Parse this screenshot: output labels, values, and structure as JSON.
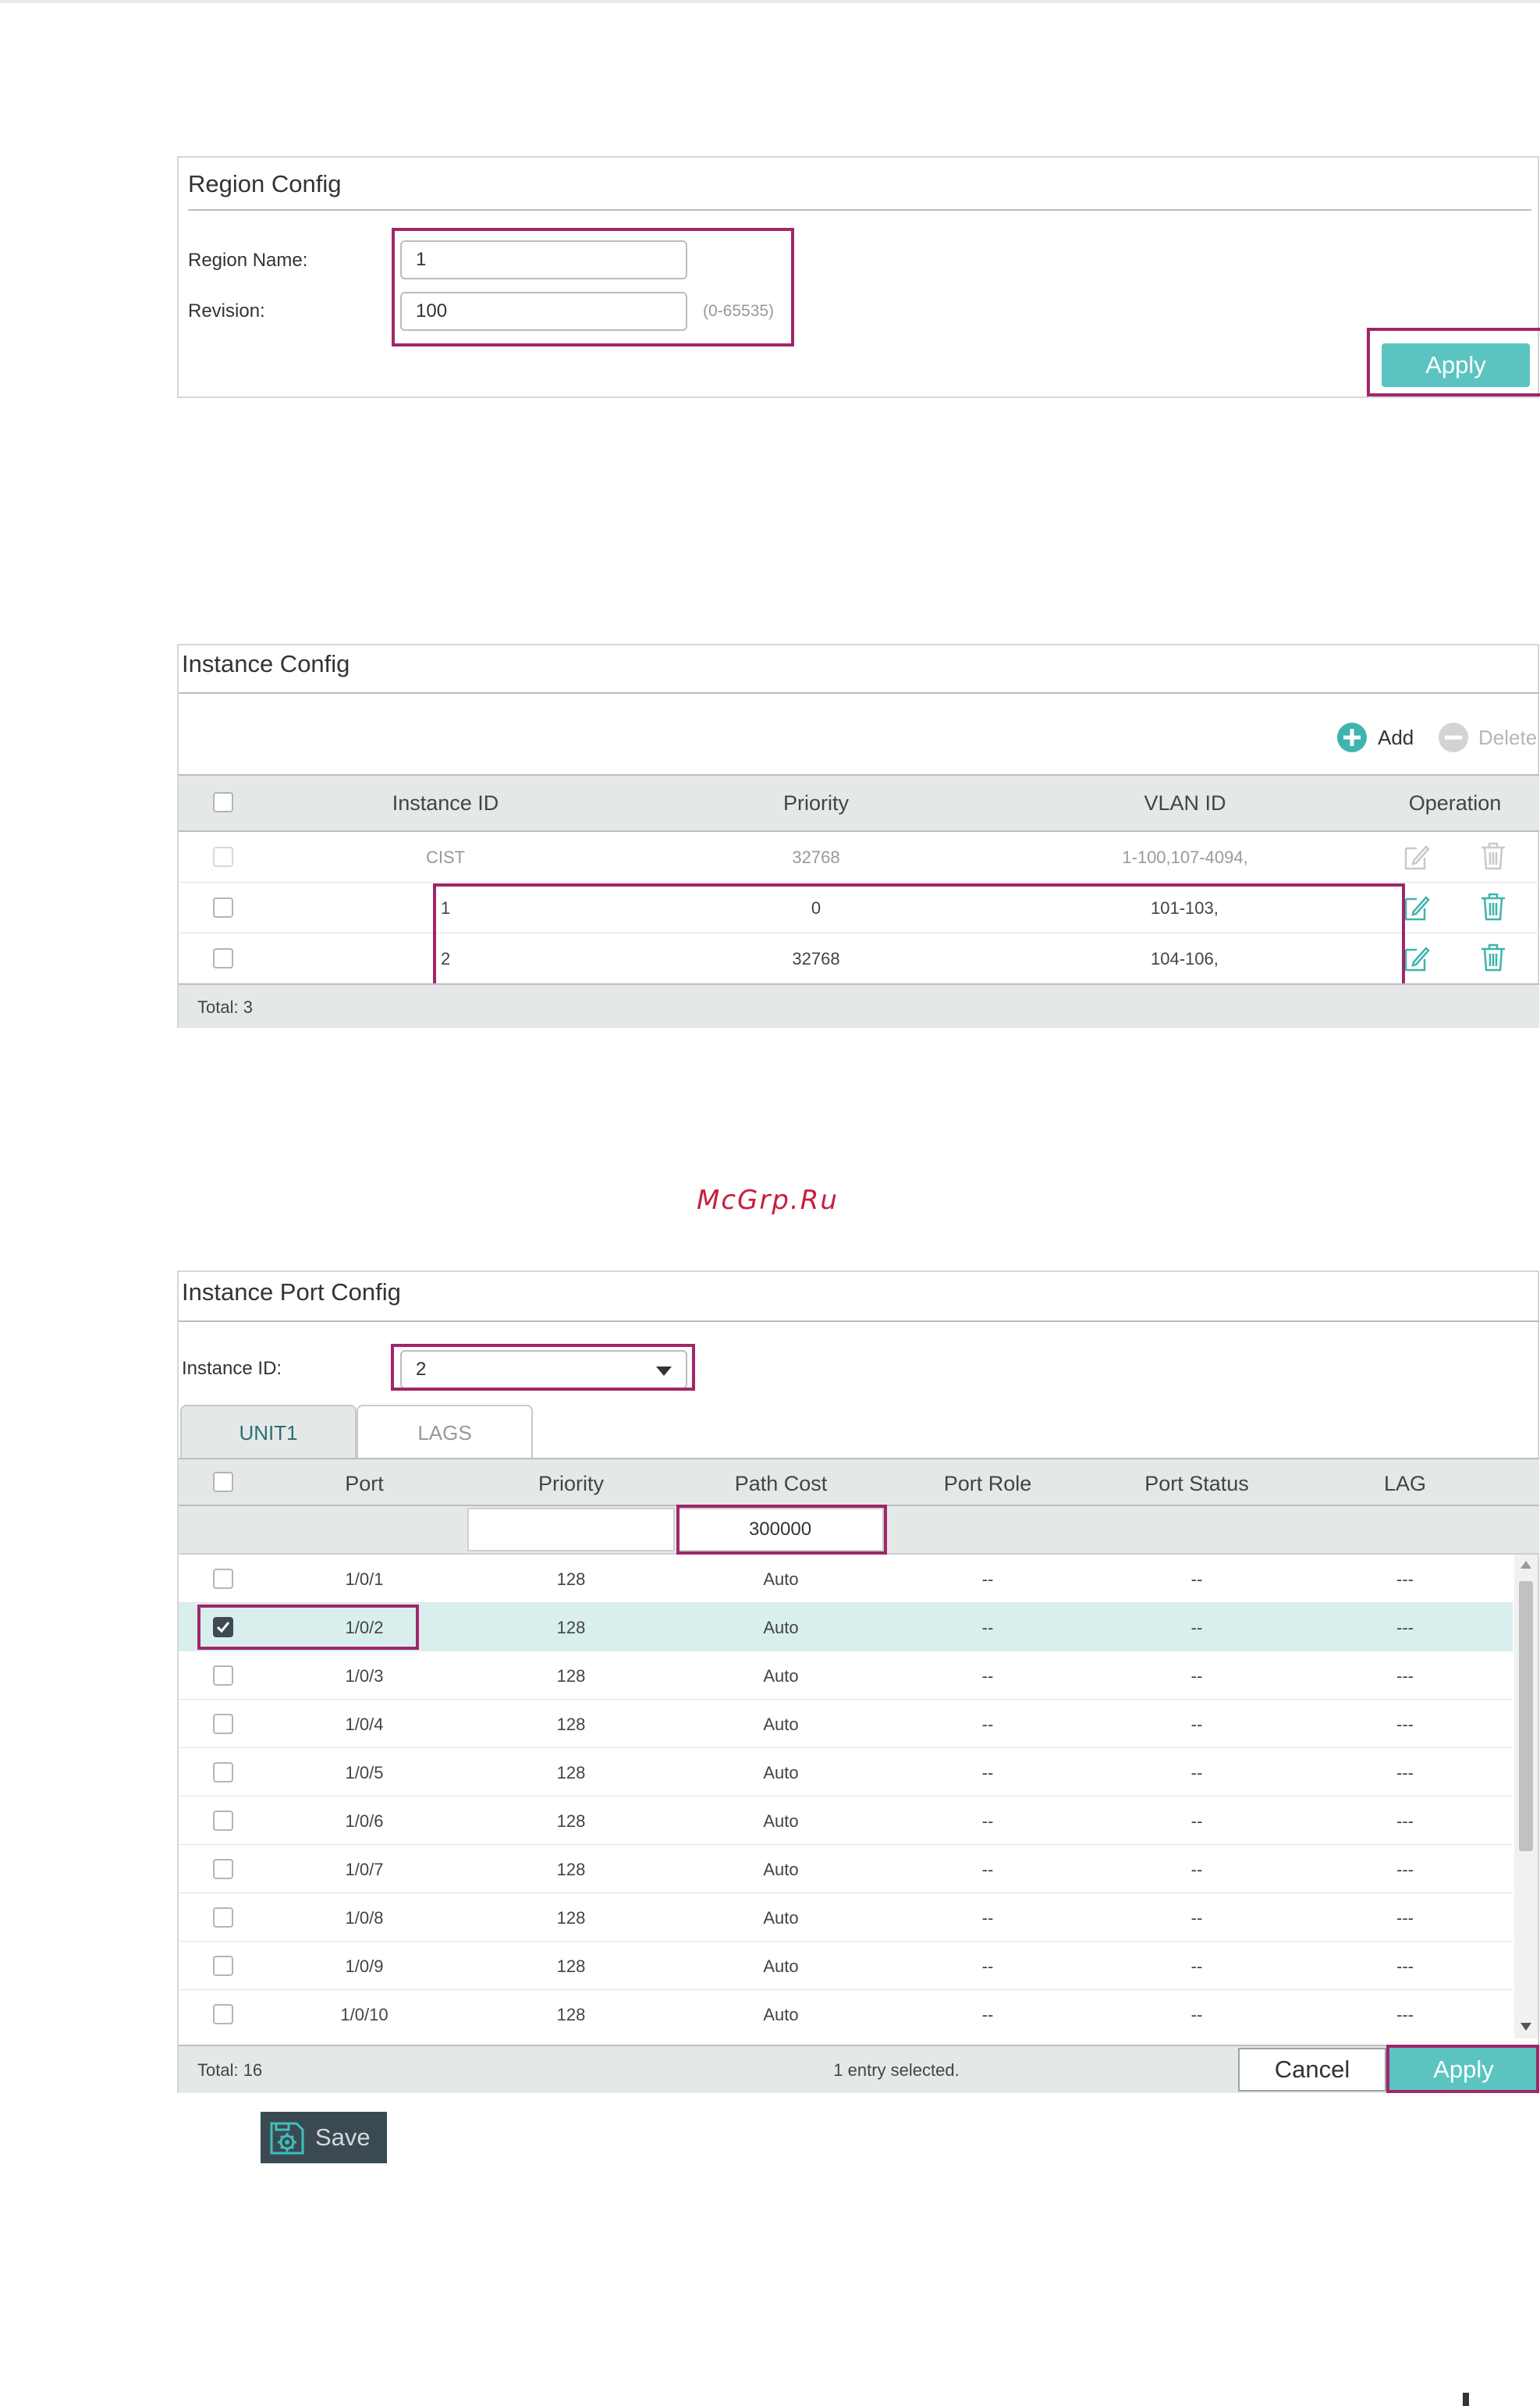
{
  "watermark": "McGrp.Ru",
  "region_config": {
    "title": "Region Config",
    "region_name_label": "Region Name:",
    "region_name_value": "1",
    "revision_label": "Revision:",
    "revision_value": "100",
    "revision_hint": "(0-65535)",
    "apply_label": "Apply"
  },
  "instance_config": {
    "title": "Instance Config",
    "add_label": "Add",
    "delete_label": "Delete",
    "columns": [
      "Instance ID",
      "Priority",
      "VLAN ID",
      "Operation"
    ],
    "rows": [
      {
        "id": "CIST",
        "priority": "32768",
        "vlan": "1-100,107-4094,",
        "disabled": true
      },
      {
        "id": "1",
        "priority": "0",
        "vlan": "101-103,",
        "disabled": false
      },
      {
        "id": "2",
        "priority": "32768",
        "vlan": "104-106,",
        "disabled": false
      }
    ],
    "total": "Total: 3"
  },
  "instance_port_config": {
    "title": "Instance Port Config",
    "instance_id_label": "Instance ID:",
    "instance_id_value": "2",
    "tabs": [
      "UNIT1",
      "LAGS"
    ],
    "active_tab": "UNIT1",
    "columns": [
      "Port",
      "Priority",
      "Path Cost",
      "Port Role",
      "Port Status",
      "LAG"
    ],
    "path_cost_input": "300000",
    "rows": [
      {
        "port": "1/0/1",
        "priority": "128",
        "path_cost": "Auto",
        "role": "--",
        "status": "--",
        "lag": "---",
        "checked": false
      },
      {
        "port": "1/0/2",
        "priority": "128",
        "path_cost": "Auto",
        "role": "--",
        "status": "--",
        "lag": "---",
        "checked": true
      },
      {
        "port": "1/0/3",
        "priority": "128",
        "path_cost": "Auto",
        "role": "--",
        "status": "--",
        "lag": "---",
        "checked": false
      },
      {
        "port": "1/0/4",
        "priority": "128",
        "path_cost": "Auto",
        "role": "--",
        "status": "--",
        "lag": "---",
        "checked": false
      },
      {
        "port": "1/0/5",
        "priority": "128",
        "path_cost": "Auto",
        "role": "--",
        "status": "--",
        "lag": "---",
        "checked": false
      },
      {
        "port": "1/0/6",
        "priority": "128",
        "path_cost": "Auto",
        "role": "--",
        "status": "--",
        "lag": "---",
        "checked": false
      },
      {
        "port": "1/0/7",
        "priority": "128",
        "path_cost": "Auto",
        "role": "--",
        "status": "--",
        "lag": "---",
        "checked": false
      },
      {
        "port": "1/0/8",
        "priority": "128",
        "path_cost": "Auto",
        "role": "--",
        "status": "--",
        "lag": "---",
        "checked": false
      },
      {
        "port": "1/0/9",
        "priority": "128",
        "path_cost": "Auto",
        "role": "--",
        "status": "--",
        "lag": "---",
        "checked": false
      },
      {
        "port": "1/0/10",
        "priority": "128",
        "path_cost": "Auto",
        "role": "--",
        "status": "--",
        "lag": "---",
        "checked": false
      }
    ],
    "total": "Total: 16",
    "selected_text": "1 entry selected.",
    "cancel_label": "Cancel",
    "apply_label": "Apply"
  },
  "save": {
    "label": "Save",
    "icon": "save-gear-icon"
  },
  "colors": {
    "accent": "#5bc4c1",
    "highlight": "#a0266a",
    "selected_row": "#d9efee",
    "save_bg": "#3b4a52"
  }
}
